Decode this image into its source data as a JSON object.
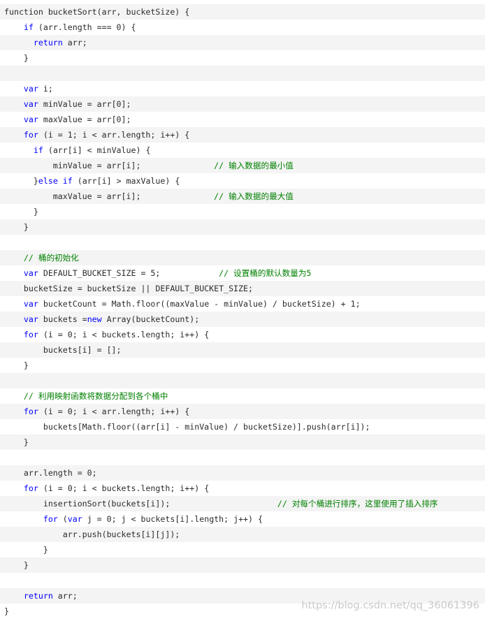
{
  "colors": {
    "keyword": "#0000ff",
    "comment": "#008000",
    "text": "#2b2b2b",
    "stripe": "#f4f4f4"
  },
  "code_lines": [
    [
      [
        "plain",
        "function bucketSort(arr, bucketSize) {"
      ]
    ],
    [
      [
        "plain",
        "    "
      ],
      [
        "kw",
        "if"
      ],
      [
        "plain",
        " (arr.length === 0) {"
      ]
    ],
    [
      [
        "plain",
        "      "
      ],
      [
        "kw",
        "return"
      ],
      [
        "plain",
        " arr;"
      ]
    ],
    [
      [
        "plain",
        "    }"
      ]
    ],
    [
      [
        "plain",
        ""
      ]
    ],
    [
      [
        "plain",
        "    "
      ],
      [
        "kw",
        "var"
      ],
      [
        "plain",
        " i;"
      ]
    ],
    [
      [
        "plain",
        "    "
      ],
      [
        "kw",
        "var"
      ],
      [
        "plain",
        " minValue = arr[0];"
      ]
    ],
    [
      [
        "plain",
        "    "
      ],
      [
        "kw",
        "var"
      ],
      [
        "plain",
        " maxValue = arr[0];"
      ]
    ],
    [
      [
        "plain",
        "    "
      ],
      [
        "kw",
        "for"
      ],
      [
        "plain",
        " (i = 1; i < arr.length; i++) {"
      ]
    ],
    [
      [
        "plain",
        "      "
      ],
      [
        "kw",
        "if"
      ],
      [
        "plain",
        " (arr[i] < minValue) {"
      ]
    ],
    [
      [
        "plain",
        "          minValue = arr[i];               "
      ],
      [
        "cm",
        "// 输入数据的最小值"
      ]
    ],
    [
      [
        "plain",
        "      }"
      ],
      [
        "kw",
        "else if"
      ],
      [
        "plain",
        " (arr[i] > maxValue) {"
      ]
    ],
    [
      [
        "plain",
        "          maxValue = arr[i];               "
      ],
      [
        "cm",
        "// 输入数据的最大值"
      ]
    ],
    [
      [
        "plain",
        "      }"
      ]
    ],
    [
      [
        "plain",
        "    }"
      ]
    ],
    [
      [
        "plain",
        ""
      ]
    ],
    [
      [
        "plain",
        "    "
      ],
      [
        "cm",
        "// 桶的初始化"
      ]
    ],
    [
      [
        "plain",
        "    "
      ],
      [
        "kw",
        "var"
      ],
      [
        "plain",
        " DEFAULT_BUCKET_SIZE = 5;            "
      ],
      [
        "cm",
        "// 设置桶的默认数量为5"
      ]
    ],
    [
      [
        "plain",
        "    bucketSize = bucketSize || DEFAULT_BUCKET_SIZE;"
      ]
    ],
    [
      [
        "plain",
        "    "
      ],
      [
        "kw",
        "var"
      ],
      [
        "plain",
        " bucketCount = Math.floor((maxValue - minValue) / bucketSize) + 1;"
      ]
    ],
    [
      [
        "plain",
        "    "
      ],
      [
        "kw",
        "var"
      ],
      [
        "plain",
        " buckets ="
      ],
      [
        "kw",
        "new"
      ],
      [
        "plain",
        " Array(bucketCount);"
      ]
    ],
    [
      [
        "plain",
        "    "
      ],
      [
        "kw",
        "for"
      ],
      [
        "plain",
        " (i = 0; i < buckets.length; i++) {"
      ]
    ],
    [
      [
        "plain",
        "        buckets[i] = [];"
      ]
    ],
    [
      [
        "plain",
        "    }"
      ]
    ],
    [
      [
        "plain",
        ""
      ]
    ],
    [
      [
        "plain",
        "    "
      ],
      [
        "cm",
        "// 利用映射函数将数据分配到各个桶中"
      ]
    ],
    [
      [
        "plain",
        "    "
      ],
      [
        "kw",
        "for"
      ],
      [
        "plain",
        " (i = 0; i < arr.length; i++) {"
      ]
    ],
    [
      [
        "plain",
        "        buckets[Math.floor((arr[i] - minValue) / bucketSize)].push(arr[i]);"
      ]
    ],
    [
      [
        "plain",
        "    }"
      ]
    ],
    [
      [
        "plain",
        ""
      ]
    ],
    [
      [
        "plain",
        "    arr.length = 0;"
      ]
    ],
    [
      [
        "plain",
        "    "
      ],
      [
        "kw",
        "for"
      ],
      [
        "plain",
        " (i = 0; i < buckets.length; i++) {"
      ]
    ],
    [
      [
        "plain",
        "        insertionSort(buckets[i]);                      "
      ],
      [
        "cm",
        "// 对每个桶进行排序，这里使用了插入排序"
      ]
    ],
    [
      [
        "plain",
        "        "
      ],
      [
        "kw",
        "for"
      ],
      [
        "plain",
        " ("
      ],
      [
        "kw",
        "var"
      ],
      [
        "plain",
        " j = 0; j < buckets[i].length; j++) {"
      ]
    ],
    [
      [
        "plain",
        "            arr.push(buckets[i][j]);"
      ]
    ],
    [
      [
        "plain",
        "        }"
      ]
    ],
    [
      [
        "plain",
        "    }"
      ]
    ],
    [
      [
        "plain",
        ""
      ]
    ],
    [
      [
        "plain",
        "    "
      ],
      [
        "kw",
        "return"
      ],
      [
        "plain",
        " arr;"
      ]
    ],
    [
      [
        "plain",
        "}"
      ]
    ]
  ],
  "watermark": "https://blog.csdn.net/qq_36061396"
}
